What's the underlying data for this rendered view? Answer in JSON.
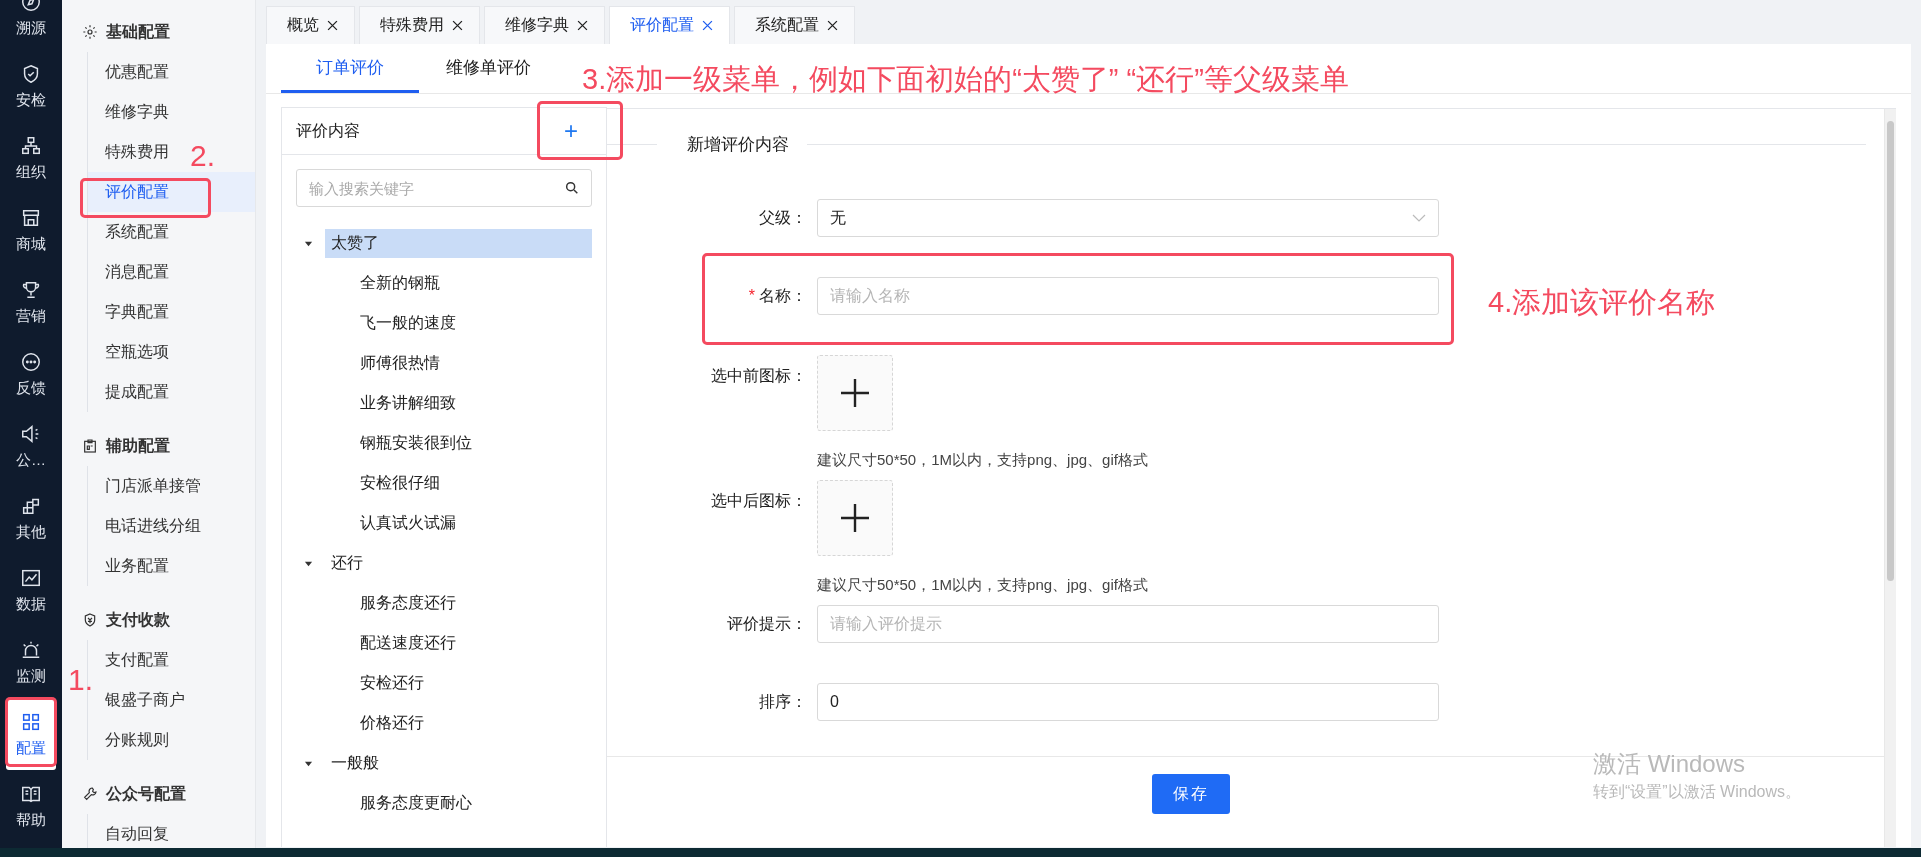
{
  "nav_rail": [
    {
      "label": "溯源",
      "selected": false
    },
    {
      "label": "安检",
      "selected": false
    },
    {
      "label": "组织",
      "selected": false
    },
    {
      "label": "商城",
      "selected": false
    },
    {
      "label": "营销",
      "selected": false
    },
    {
      "label": "反馈",
      "selected": false
    },
    {
      "label": "公…",
      "selected": false
    },
    {
      "label": "其他",
      "selected": false
    },
    {
      "label": "数据",
      "selected": false
    },
    {
      "label": "监测",
      "selected": false
    },
    {
      "label": "配置",
      "selected": true
    },
    {
      "label": "帮助",
      "selected": false
    }
  ],
  "sidebar": {
    "groups": [
      {
        "title": "基础配置",
        "items": [
          {
            "label": "优惠配置",
            "selected": false
          },
          {
            "label": "维修字典",
            "selected": false
          },
          {
            "label": "特殊费用",
            "selected": false
          },
          {
            "label": "评价配置",
            "selected": true
          },
          {
            "label": "系统配置",
            "selected": false
          },
          {
            "label": "消息配置",
            "selected": false
          },
          {
            "label": "字典配置",
            "selected": false
          },
          {
            "label": "空瓶选项",
            "selected": false
          },
          {
            "label": "提成配置",
            "selected": false
          }
        ]
      },
      {
        "title": "辅助配置",
        "items": [
          {
            "label": "门店派单接管",
            "selected": false
          },
          {
            "label": "电话进线分组",
            "selected": false
          },
          {
            "label": "业务配置",
            "selected": false
          }
        ]
      },
      {
        "title": "支付收款",
        "items": [
          {
            "label": "支付配置",
            "selected": false
          },
          {
            "label": "银盛子商户",
            "selected": false
          },
          {
            "label": "分账规则",
            "selected": false
          }
        ]
      },
      {
        "title": "公众号配置",
        "items": [
          {
            "label": "自动回复",
            "selected": false
          }
        ]
      }
    ]
  },
  "tabs": [
    {
      "label": "概览",
      "selected": false
    },
    {
      "label": "特殊费用",
      "selected": false
    },
    {
      "label": "维修字典",
      "selected": false
    },
    {
      "label": "评价配置",
      "selected": true
    },
    {
      "label": "系统配置",
      "selected": false
    }
  ],
  "subtabs": [
    {
      "label": "订单评价",
      "selected": true
    },
    {
      "label": "维修单评价",
      "selected": false
    }
  ],
  "tree_panel": {
    "title": "评价内容",
    "add_button": "+",
    "search": {
      "placeholder": "输入搜索关键字"
    },
    "tree": [
      {
        "label": "太赞了",
        "expanded": true,
        "selected": true,
        "children": [
          {
            "label": "全新的钢瓶"
          },
          {
            "label": "飞一般的速度"
          },
          {
            "label": "师傅很热情"
          },
          {
            "label": "业务讲解细致"
          },
          {
            "label": "钢瓶安装很到位"
          },
          {
            "label": "安检很仔细"
          },
          {
            "label": "认真试火试漏"
          }
        ]
      },
      {
        "label": "还行",
        "expanded": true,
        "selected": false,
        "children": [
          {
            "label": "服务态度还行"
          },
          {
            "label": "配送速度还行"
          },
          {
            "label": "安检还行"
          },
          {
            "label": "价格还行"
          }
        ]
      },
      {
        "label": "一般般",
        "expanded": true,
        "selected": false,
        "children": [
          {
            "label": "服务态度更耐心"
          }
        ]
      }
    ]
  },
  "form": {
    "legend": "新增评价内容",
    "fields": [
      {
        "kind": "select",
        "label": "父级：",
        "value": "无"
      },
      {
        "kind": "text",
        "label": "名称：",
        "required_mark": "*",
        "placeholder": "请输入名称"
      },
      {
        "kind": "upload",
        "label": "选中前图标：",
        "hint": "建议尺寸50*50，1M以内，支持png、jpg、gif格式"
      },
      {
        "kind": "upload",
        "label": "选中后图标：",
        "hint": "建议尺寸50*50，1M以内，支持png、jpg、gif格式"
      },
      {
        "kind": "text",
        "label": "评价提示：",
        "placeholder": "请输入评价提示"
      },
      {
        "kind": "value",
        "label": "排序：",
        "value": "0"
      }
    ],
    "save_button": "保存"
  },
  "annotations": [
    {
      "text": "1."
    },
    {
      "text": "2."
    },
    {
      "text": "3.添加一级菜单，例如下面初始的“太赞了” “还行”等父级菜单"
    },
    {
      "text": "4.添加该评价名称"
    }
  ],
  "os_notice": {
    "title": "激活 Windows",
    "subtitle": "转到“设置”以激活 Windows。"
  }
}
